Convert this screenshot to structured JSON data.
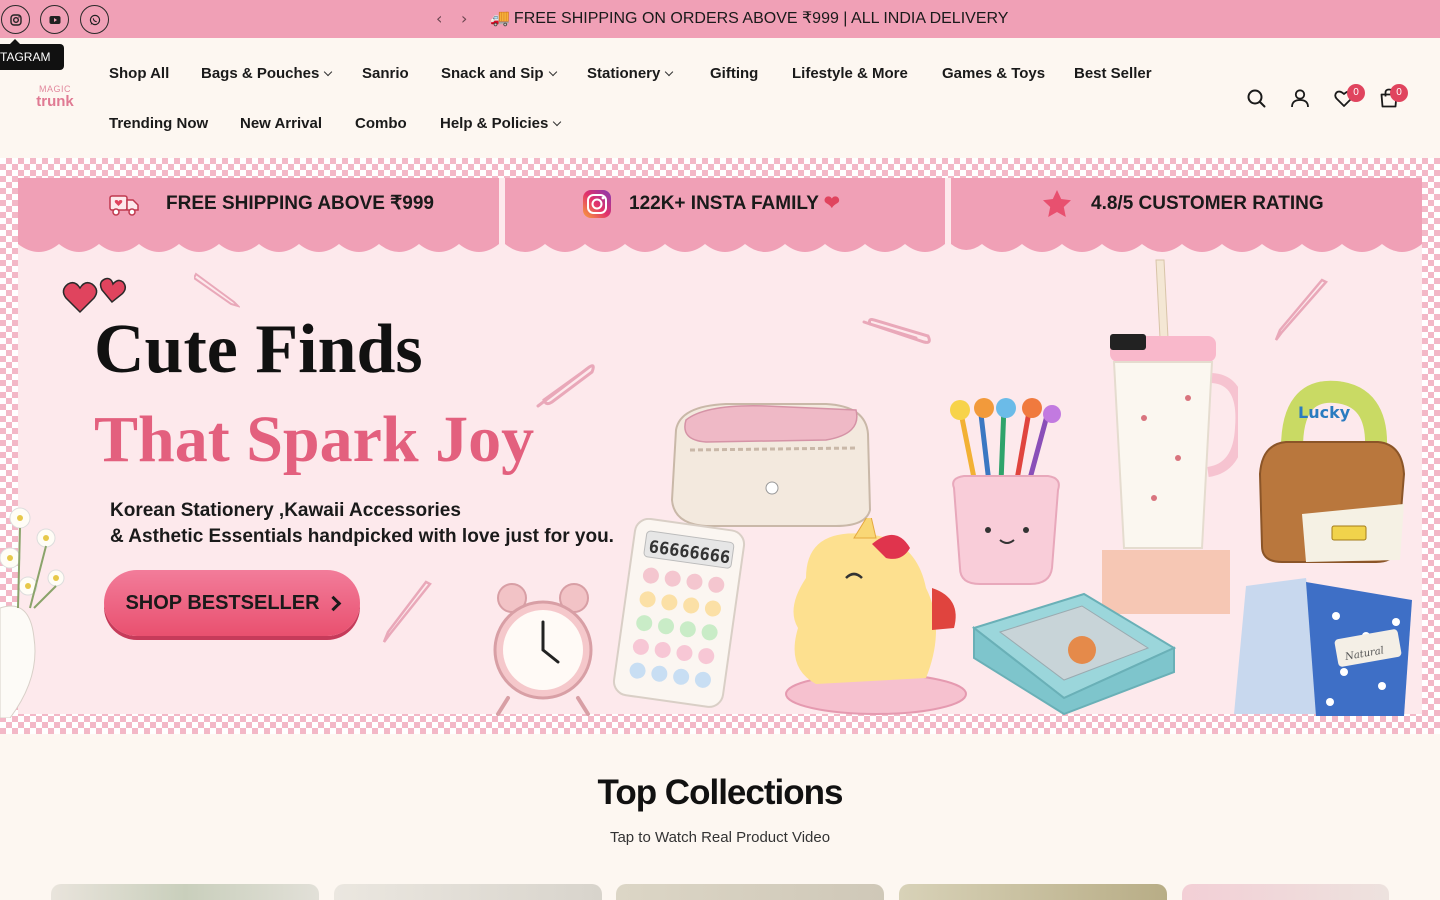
{
  "announcement": {
    "text": "FREE SHIPPING ON ORDERS ABOVE ₹999 | ALL INDIA DELIVERY",
    "truck_icon": "truck-icon",
    "prev_icon": "chevron-left-icon",
    "next_icon": "chevron-right-icon",
    "background": "#f0a0b6"
  },
  "social": {
    "items": [
      "instagram-icon",
      "youtube-icon",
      "whatsapp-icon"
    ],
    "tooltip": "TAGRAM"
  },
  "logo": {
    "top_text": "MAGIC",
    "bottom_text": "trunk"
  },
  "nav": {
    "row1": [
      {
        "label": "Shop All",
        "dropdown": false
      },
      {
        "label": "Bags & Pouches",
        "dropdown": true
      },
      {
        "label": "Sanrio",
        "dropdown": false
      },
      {
        "label": "Snack and Sip",
        "dropdown": true
      },
      {
        "label": "Stationery",
        "dropdown": true
      },
      {
        "label": "Gifting",
        "dropdown": false
      },
      {
        "label": "Lifestyle & More",
        "dropdown": false
      },
      {
        "label": "Games & Toys",
        "dropdown": false
      },
      {
        "label": "Best Seller",
        "dropdown": false
      }
    ],
    "row2": [
      {
        "label": "Trending Now",
        "dropdown": false
      },
      {
        "label": "New Arrival",
        "dropdown": false
      },
      {
        "label": "Combo",
        "dropdown": false
      },
      {
        "label": "Help & Policies",
        "dropdown": true
      }
    ]
  },
  "header_icons": {
    "search": "search-icon",
    "account": "user-icon",
    "wishlist": "heart-icon",
    "wishlist_count": "0",
    "cart": "bag-icon",
    "cart_count": "0"
  },
  "hero": {
    "banners": [
      {
        "text": "FREE SHIPPING ABOVE ₹999",
        "icon": "delivery-truck-icon"
      },
      {
        "text": "122K+ INSTA FAMILY",
        "icon": "instagram-icon"
      },
      {
        "text": "4.8/5 CUSTOMER RATING",
        "icon": "star-icon"
      }
    ],
    "title": "Cute Finds",
    "subtitle": "That Spark Joy",
    "description_line1": "Korean Stationery ,Kawaii Accessories",
    "description_line2": "& Asthetic Essentials handpicked  with love just for you.",
    "cta": "SHOP BESTSELLER",
    "calculator_display": "66666666",
    "bag_tag": "Lucky",
    "notebook_text": "Natural",
    "accent": "#e3607e"
  },
  "collections": {
    "title": "Top Collections",
    "subtitle": "Tap to Watch Real Product Video"
  }
}
